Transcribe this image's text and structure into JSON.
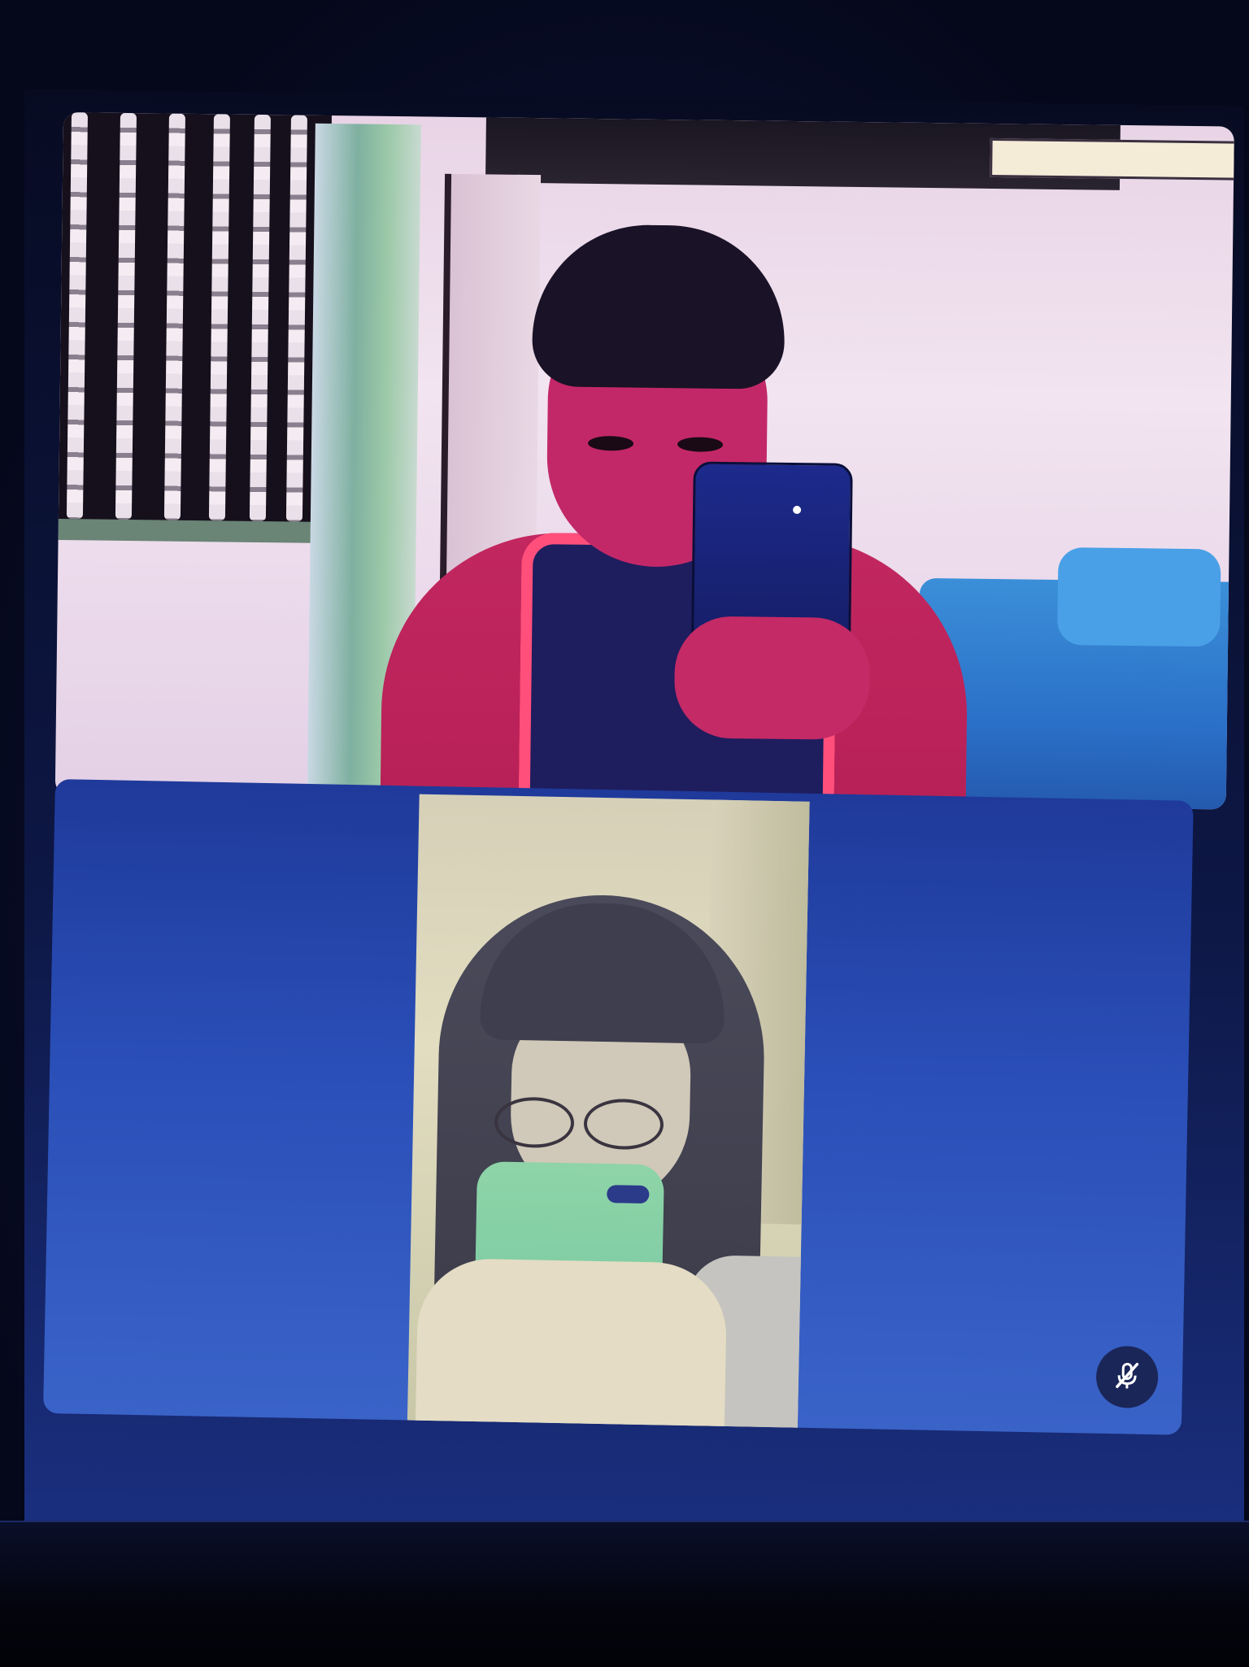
{
  "meeting": {
    "participants": [
      {
        "tile": "top",
        "video": "on"
      },
      {
        "tile": "bottom",
        "video": "on",
        "muted": true
      }
    ]
  },
  "icons": {
    "mute": "microphone-off-icon"
  },
  "colors": {
    "background": "#05081a",
    "tile_background": "#2a4fb8",
    "mute_button": "#1a2658"
  }
}
